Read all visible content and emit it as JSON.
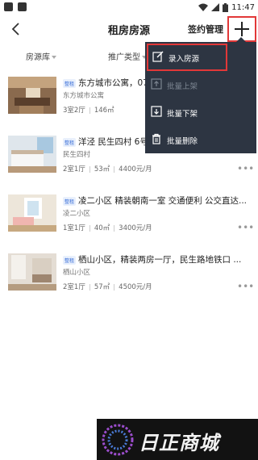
{
  "status_bar": {
    "time": "11:47"
  },
  "header": {
    "title": "租房房源",
    "sign_label": "签约管理"
  },
  "filters": [
    {
      "label": "房源库"
    },
    {
      "label": "推广类型"
    }
  ],
  "listings": [
    {
      "badge": "整租",
      "title": "东方城市公寓，07",
      "community": "东方城市公寓",
      "layout": "3室2厅",
      "area": "146㎡",
      "price": ""
    },
    {
      "badge": "整租",
      "title": "洋泾 民生四村 6号",
      "community": "民生四村",
      "layout": "2室1厅",
      "area": "53㎡",
      "price": "4400元/月"
    },
    {
      "badge": "整租",
      "title": "凌二小区 精装朝南一室 交通便利 公交直达...",
      "community": "凌二小区",
      "layout": "1室1厅",
      "area": "40㎡",
      "price": "3400元/月"
    },
    {
      "badge": "整租",
      "title": "栖山小区，精装两房一厅，民生路地铁口 ...",
      "community": "栖山小区",
      "layout": "2室1厅",
      "area": "57㎡",
      "price": "4500元/月"
    }
  ],
  "menu": {
    "items": [
      {
        "label": "录入房源",
        "icon": "edit-icon",
        "enabled": true
      },
      {
        "label": "批量上架",
        "icon": "upload-icon",
        "enabled": false
      },
      {
        "label": "批量下架",
        "icon": "download-icon",
        "enabled": true
      },
      {
        "label": "批量删除",
        "icon": "trash-icon",
        "enabled": true
      }
    ]
  },
  "watermark": {
    "text": "日正商城"
  },
  "colors": {
    "menu_bg": "#2d3542",
    "highlight": "#e23838",
    "badge": "#3a6fd8"
  }
}
